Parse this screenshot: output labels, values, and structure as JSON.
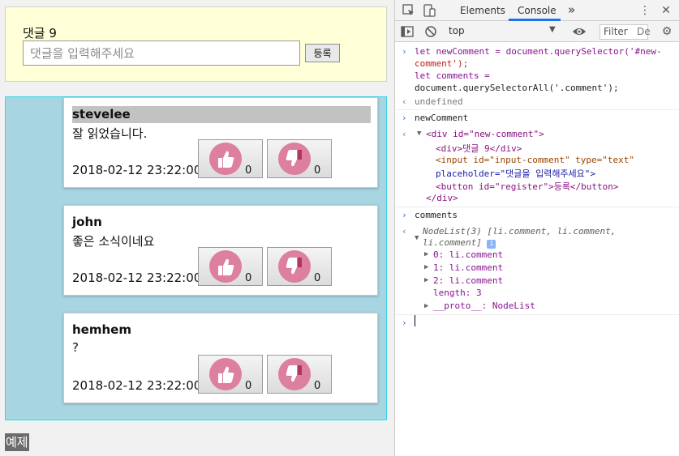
{
  "new_comment": {
    "title": "댓글 9",
    "placeholder": "댓글을 입력해주세요",
    "register_label": "등록"
  },
  "comments": [
    {
      "author": "stevelee",
      "text": "잘 읽었습니다.",
      "date": "2018-02-12 23:22:00",
      "likes": "0",
      "dislikes": "0"
    },
    {
      "author": "john",
      "text": "좋은 소식이네요",
      "date": "2018-02-12 23:22:00",
      "likes": "0",
      "dislikes": "0"
    },
    {
      "author": "hemhem",
      "text": "?",
      "date": "2018-02-12 23:22:00",
      "likes": "0",
      "dislikes": "0"
    }
  ],
  "example_label": "예제",
  "devtools": {
    "tabs": [
      "Elements",
      "Console"
    ],
    "more": "»",
    "context": "top",
    "filter": "Filter",
    "levels": "De",
    "console": {
      "l1a": "let newComment = document.querySelector('#new-",
      "l1b": "comment');",
      "l1c": "let comments =",
      "l1d": "document.querySelectorAll('.comment');",
      "r1": "undefined",
      "l2": "newComment",
      "e1": "<div id=\"new-comment\">",
      "e2": "<div>댓글 9</div>",
      "e3": "<input id=\"input-comment\" type=\"text\"",
      "e4": "placeholder=\"댓글을 입력해주세요\">",
      "e5": "<button id=\"register\">등록</button>",
      "e6": "</div>",
      "l3": "comments",
      "n1": "NodeList(3) [li.comment, li.comment,",
      "n2": "li.comment]",
      "n3": "0: li.comment",
      "n4": "1: li.comment",
      "n5": "2: li.comment",
      "n6": "length: 3",
      "n7": "__proto__: NodeList"
    }
  }
}
